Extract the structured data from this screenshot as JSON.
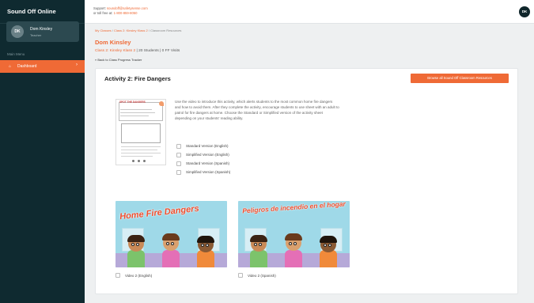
{
  "app": {
    "title": "Sound Off Online"
  },
  "sidebar": {
    "user": {
      "name": "Dom Kinsley",
      "role": "Teacher",
      "initials": "DK"
    },
    "menu_label": "Main Menu",
    "items": [
      {
        "label": "Dashboard",
        "icon": "home-icon",
        "active": true
      }
    ]
  },
  "topbar": {
    "support_prefix": "Support:",
    "support_email": "soundoff@safetysense.com",
    "support_phone_prefix": "or toll free at:",
    "support_phone": "1-800-859-8050",
    "avatar_initials": "DK"
  },
  "breadcrumb": [
    "My Classes",
    "Class 2: Kinsley Klass 2",
    "Classroom Resources"
  ],
  "header": {
    "student_name": "Dom Kinsley",
    "class_name": "Class 2: Kinsley Klass 2",
    "students": "20 Students",
    "visits": "0 FF Visits",
    "back_link": "« Back to Class Progress Tracker"
  },
  "activity": {
    "title": "Activity 2: Fire Dangers",
    "browse_button": "Browse all Sound Off Classroom Resources",
    "worksheet_title": "SPOT THE DANGERS",
    "description": "Use the video to introduce this activity, which alerts students to the most common home fire dangers and how to avoid them. After they complete the activity, encourage students to use sheet with an adult to patrol for fire dangers at home. Choose the Standard or Simplified version of the activity sheet depending on your students' reading ability.",
    "versions": [
      "Standard Version (English)",
      "Simplified Version (English)",
      "Standard Version (Spanish)",
      "Simplified Version (Spanish)"
    ],
    "videos": [
      {
        "title": "Home Fire Dangers",
        "label": "Video 2 (English)"
      },
      {
        "title": "Peligros de incendio en el hogar",
        "label": "Video 2 (Spanish)"
      }
    ]
  },
  "colors": {
    "sidebar": "#0f2a30",
    "accent": "#ef6a36",
    "thumbnail_bg": "#9fd9e8"
  }
}
